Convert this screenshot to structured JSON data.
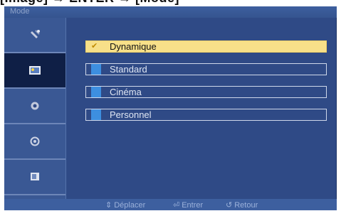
{
  "caption": {
    "text": "[Image] → ENTER → [Mode]"
  },
  "osd": {
    "title": "Mode",
    "side_icons": [
      {
        "name": "satellite-icon"
      },
      {
        "name": "picture-icon"
      },
      {
        "name": "sound-icon"
      },
      {
        "name": "setup-icon"
      },
      {
        "name": "input-icon"
      }
    ],
    "options": [
      {
        "label": "Dynamique",
        "selected": true,
        "mark": "✔"
      },
      {
        "label": "Standard",
        "selected": false
      },
      {
        "label": "Cinéma",
        "selected": false
      },
      {
        "label": "Personnel",
        "selected": false
      }
    ],
    "footer": {
      "move": "Déplacer",
      "enter": "Entrer",
      "return": "Retour"
    }
  }
}
